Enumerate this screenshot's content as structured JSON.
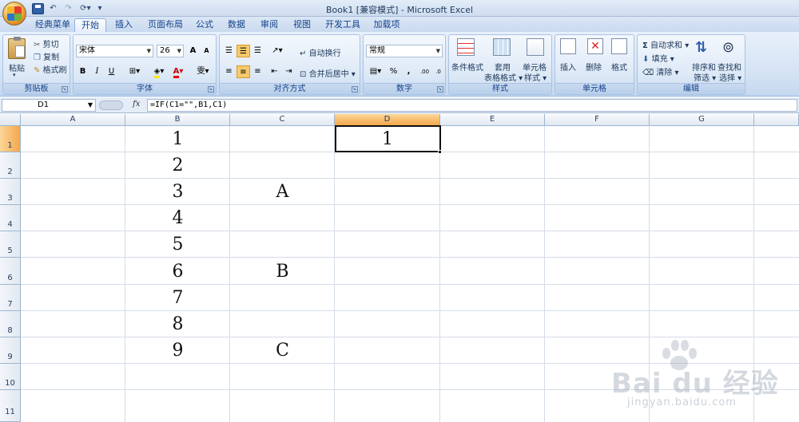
{
  "window": {
    "title": "Book1  [兼容模式] - Microsoft Excel"
  },
  "tabs": [
    {
      "label": "经典菜单",
      "active": false
    },
    {
      "label": "开始",
      "active": true
    },
    {
      "label": "插入",
      "active": false
    },
    {
      "label": "页面布局",
      "active": false
    },
    {
      "label": "公式",
      "active": false
    },
    {
      "label": "数据",
      "active": false
    },
    {
      "label": "审阅",
      "active": false
    },
    {
      "label": "视图",
      "active": false
    },
    {
      "label": "开发工具",
      "active": false
    },
    {
      "label": "加载项",
      "active": false
    }
  ],
  "ribbon": {
    "clipboard": {
      "label": "剪贴板",
      "paste": "粘贴",
      "cut": "剪切",
      "copy": "复制",
      "format_painter": "格式刷"
    },
    "font": {
      "label": "字体",
      "font_name": "宋体",
      "font_size": "26",
      "bold": "B",
      "italic": "I",
      "underline": "U",
      "grow": "A",
      "shrink": "A",
      "wen": "雯"
    },
    "alignment": {
      "label": "对齐方式",
      "wrap": "自动换行",
      "merge": "合并后居中"
    },
    "number": {
      "label": "数字",
      "format": "常规",
      "percent": "%",
      "comma": ",",
      "inc_decimal": ".00",
      "dec_decimal": ".0"
    },
    "styles": {
      "label": "样式",
      "conditional": "条件格式",
      "table1": "套用",
      "table2": "表格格式",
      "cell1": "单元格",
      "cell2": "样式"
    },
    "cells": {
      "label": "单元格",
      "insert": "插入",
      "delete": "删除",
      "format": "格式"
    },
    "editing": {
      "label": "编辑",
      "autosum": "自动求和",
      "fill": "填充",
      "clear": "清除",
      "sort1": "排序和",
      "sort2": "筛选",
      "find1": "查找和",
      "find2": "选择"
    }
  },
  "formula_bar": {
    "name_box": "D1",
    "fx": "fx",
    "formula": "=IF(C1=\"\",B1,C1)"
  },
  "columns": [
    "A",
    "B",
    "C",
    "D",
    "E",
    "F",
    "G"
  ],
  "rows": [
    "1",
    "2",
    "3",
    "4",
    "5",
    "6",
    "7",
    "8",
    "9",
    "10",
    "11"
  ],
  "selected_cell": "D1",
  "cells": {
    "B1": "1",
    "B2": "2",
    "B3": "3",
    "B4": "4",
    "B5": "5",
    "B6": "6",
    "B7": "7",
    "B8": "8",
    "B9": "9",
    "C3": "A",
    "C6": "B",
    "C9": "C",
    "D1": "1"
  },
  "watermark": {
    "brand": "Bai du 经验",
    "url": "jingyan.baidu.com"
  },
  "colors": {
    "selection_header": "#f4a74a",
    "ribbon_bg": "#d6e4f5",
    "grid_line": "#d4dce7"
  }
}
